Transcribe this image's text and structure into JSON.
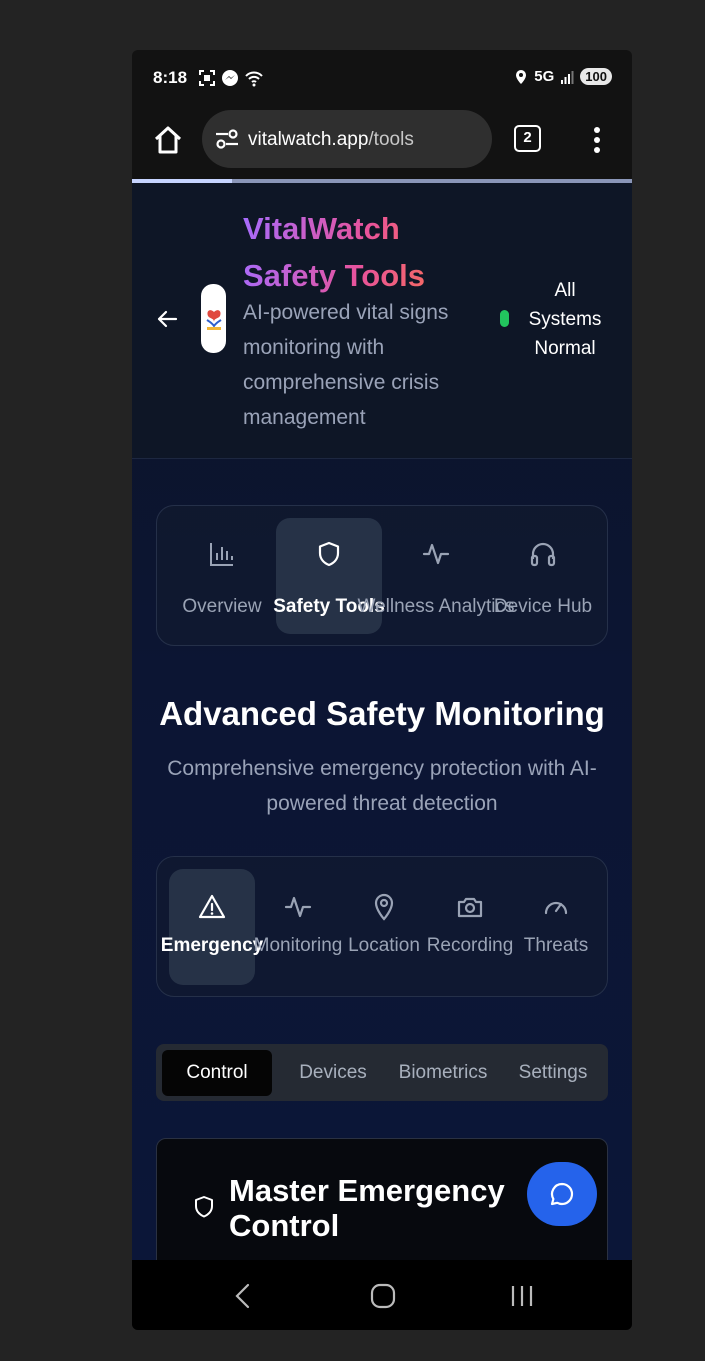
{
  "status_bar": {
    "time": "8:18",
    "network": "5G",
    "battery": "100"
  },
  "browser": {
    "url_host": "vitalwatch.app",
    "url_path": "/tools",
    "tab_count": "2",
    "load_progress": 0.2
  },
  "header": {
    "title_line1": "VitalWatch",
    "title_line2": "Safety Tools",
    "subtitle": "AI-powered vital signs monitoring with comprehensive crisis management",
    "status_line1": "All",
    "status_line2": "Systems",
    "status_line3": "Normal",
    "status_color": "#22c55e"
  },
  "nav_tabs": [
    {
      "label": "Overview",
      "icon": "bar-chart-icon",
      "active": false
    },
    {
      "label": "Safety Tools",
      "icon": "shield-icon",
      "active": true
    },
    {
      "label": "Wellness Analytics",
      "icon": "activity-icon",
      "active": false
    },
    {
      "label": "Device Hub",
      "icon": "headphones-icon",
      "active": false
    }
  ],
  "section": {
    "title": "Advanced Safety Monitoring",
    "subtitle": "Comprehensive emergency protection with AI-powered threat detection"
  },
  "tool_tabs": [
    {
      "label": "Emergency",
      "icon": "alert-triangle-icon",
      "active": true
    },
    {
      "label": "Monitoring",
      "icon": "activity-icon",
      "active": false
    },
    {
      "label": "Location",
      "icon": "map-pin-icon",
      "active": false
    },
    {
      "label": "Recording",
      "icon": "camera-icon",
      "active": false
    },
    {
      "label": "Threats",
      "icon": "gauge-icon",
      "active": false
    }
  ],
  "segments": [
    {
      "label": "Control",
      "active": true
    },
    {
      "label": "Devices",
      "active": false
    },
    {
      "label": "Biometrics",
      "active": false
    },
    {
      "label": "Settings",
      "active": false
    }
  ],
  "card": {
    "title": "Master Emergency Control"
  },
  "colors": {
    "accent_blue": "#2563eb",
    "active_tab_bg": "#263247",
    "page_bg": "#0c1533"
  }
}
